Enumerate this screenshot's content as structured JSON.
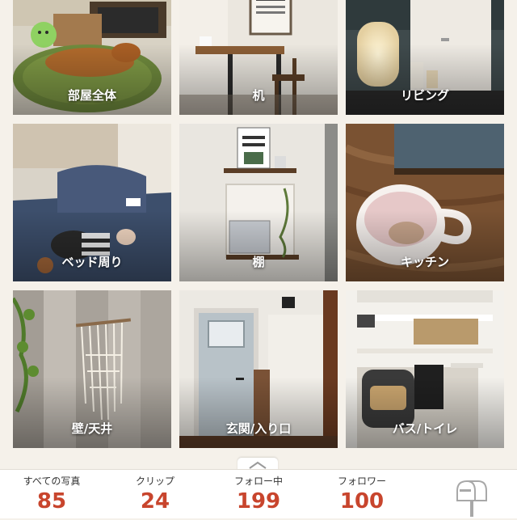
{
  "gallery": {
    "tiles": [
      {
        "label": "部屋全体",
        "photo": "living-room-dog-rug"
      },
      {
        "label": "机",
        "photo": "desk-and-chair"
      },
      {
        "label": "リビング",
        "photo": "lamp-and-shelf"
      },
      {
        "label": "ベッド周り",
        "photo": "bed-sleeping-child"
      },
      {
        "label": "棚",
        "photo": "wall-shelf-niche"
      },
      {
        "label": "キッチン",
        "photo": "coffee-cup-on-wood"
      },
      {
        "label": "壁/天井",
        "photo": "macrame-wall-hanging"
      },
      {
        "label": "玄関/入り口",
        "photo": "entrance-door-welcome"
      },
      {
        "label": "バス/トイレ",
        "photo": "cat-litter-box-shelf"
      }
    ]
  },
  "handle": {
    "icon": "chevron-up-icon"
  },
  "stats": {
    "photos": {
      "label": "すべての写真",
      "value": "85"
    },
    "clips": {
      "label": "クリップ",
      "value": "24"
    },
    "following": {
      "label": "フォロー中",
      "value": "199"
    },
    "followers": {
      "label": "フォロワー",
      "value": "100"
    }
  },
  "mailbox": {
    "icon": "mailbox-icon"
  },
  "colors": {
    "accent": "#c8452d",
    "background": "#f5f1ea"
  }
}
